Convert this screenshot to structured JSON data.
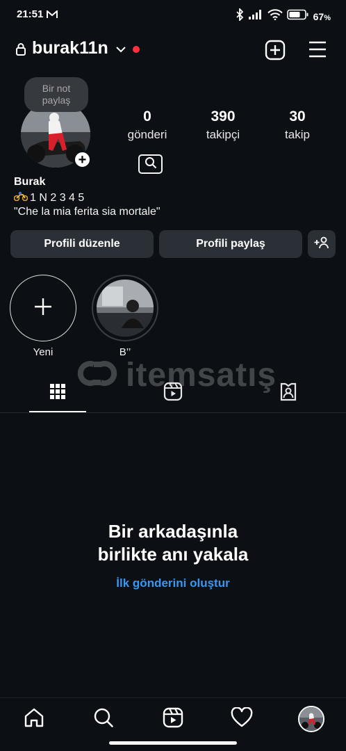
{
  "status_bar": {
    "time": "21:51",
    "battery": "67",
    "battery_suffix": "%",
    "icons": [
      "gmail-icon",
      "bluetooth-icon",
      "signal-icon",
      "wifi-icon",
      "battery-icon"
    ]
  },
  "header": {
    "username": "burak11n",
    "notification_dot_color": "#ff3040"
  },
  "profile": {
    "note": "Bir not paylaş",
    "stats": [
      {
        "value": "0",
        "label": "gönderi"
      },
      {
        "value": "390",
        "label": "takipçi"
      },
      {
        "value": "30",
        "label": "takip"
      }
    ],
    "name": "Burak",
    "bio_line1": "1 N 2 3 4 5",
    "bio_line2": "\"Che la mia ferita sia mortale\""
  },
  "buttons": {
    "edit": "Profili düzenle",
    "share": "Profili paylaş"
  },
  "highlights": [
    {
      "label": "Yeni"
    },
    {
      "label": "B’’"
    }
  ],
  "watermark": {
    "text": "itemsatış"
  },
  "empty_state": {
    "title_line1": "Bir arkadaşınla",
    "title_line2": "birlikte anı yakala",
    "link": "İlk gönderini oluştur",
    "link_color": "#3897f0"
  },
  "colors": {
    "background": "#0c1014",
    "button_bg": "#2b3036"
  }
}
